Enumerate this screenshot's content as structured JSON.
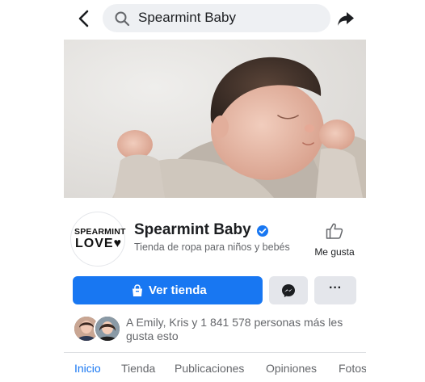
{
  "search": {
    "query": "Spearmint Baby"
  },
  "page": {
    "name": "Spearmint Baby",
    "category": "Tienda de ropa para niños y bebés",
    "logo_line1": "SPEARMINT",
    "logo_line2": "LOVE"
  },
  "like_button": {
    "label": "Me gusta"
  },
  "actions": {
    "primary_label": "Ver tienda"
  },
  "friends": {
    "text": "A Emily, Kris y 1 841 578 personas más les gusta esto"
  },
  "tabs": [
    {
      "label": "Inicio",
      "active": true
    },
    {
      "label": "Tienda"
    },
    {
      "label": "Publicaciones"
    },
    {
      "label": "Opiniones"
    },
    {
      "label": "Fotos"
    }
  ],
  "colors": {
    "accent": "#1877f2",
    "button_gray": "#e4e6eb",
    "secondary_text": "#65676b"
  }
}
